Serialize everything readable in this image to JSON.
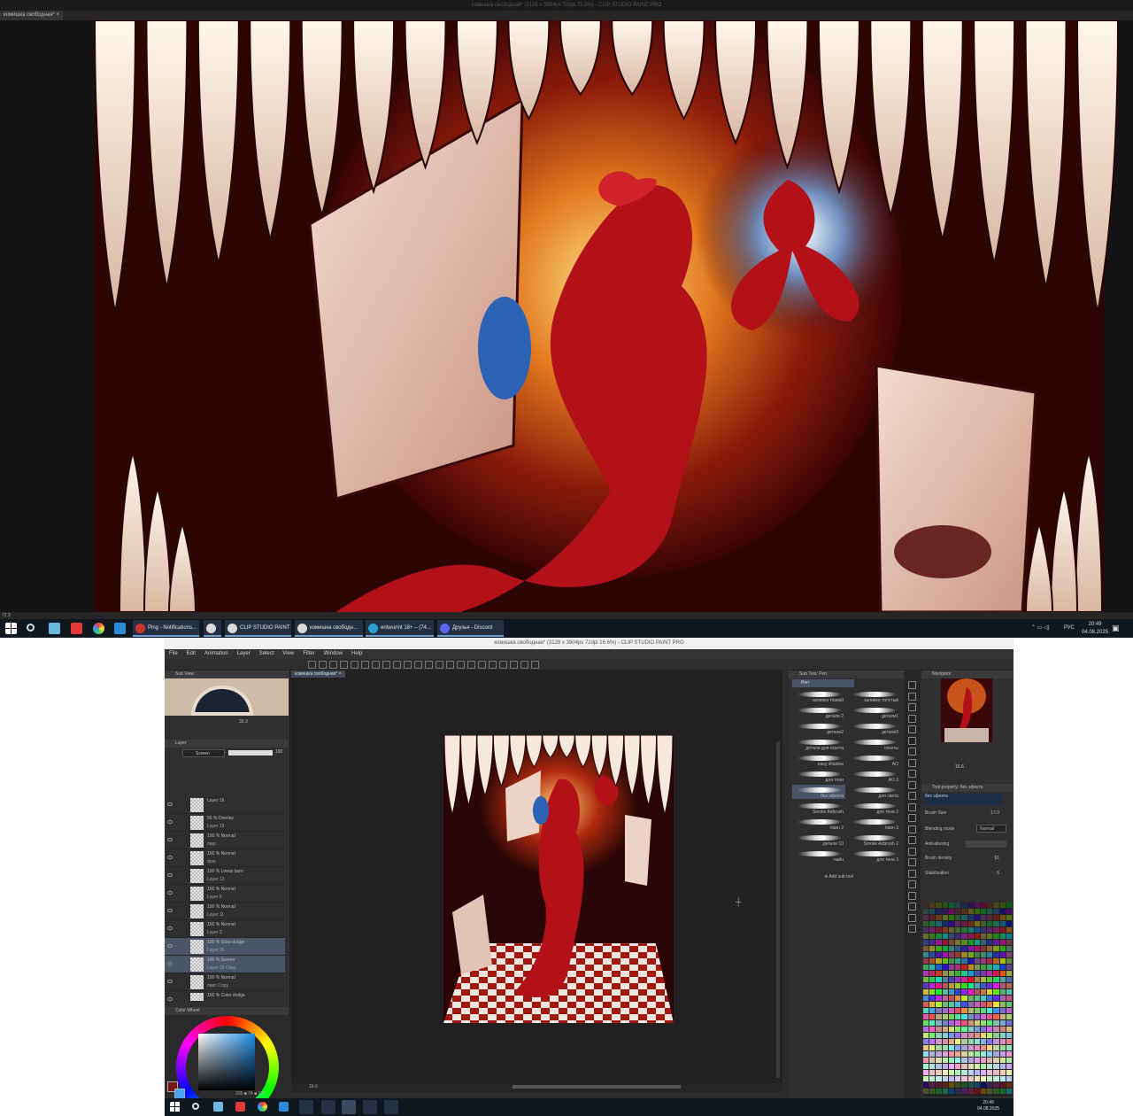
{
  "top": {
    "title": "комишка свободная* (3128 x 3904px 72dpi 72.8%)  - CLIP STUDIO PAINT PRO",
    "doc_tab": "комишка свободная*",
    "zoom": "72.9",
    "taskbar": {
      "apps": [
        {
          "label": "Ping - Notifications...",
          "color": "#c8372d"
        },
        {
          "label": "",
          "color": "#d9d9d9"
        },
        {
          "label": "CLIP STUDIO PAINT",
          "color": "#d9d9d9"
        },
        {
          "label": "комишка свободн...",
          "color": "#d9d9d9"
        },
        {
          "label": "entwurmt 18+ – (74...",
          "color": "#2aa0d8"
        },
        {
          "label": "Друзья - Discord",
          "color": "#5865f2"
        }
      ],
      "lang": "РУС",
      "time": "20:49",
      "date": "04.08.2025"
    }
  },
  "csp": {
    "title": "комишка свободная* (3128 x 3904px 72dpi 16.6%)  - CLIP STUDIO PAINT PRO",
    "menu": [
      "File",
      "Edit",
      "Animation",
      "Layer",
      "Select",
      "View",
      "Filter",
      "Window",
      "Help"
    ],
    "doc_tab": "комишка свободная*",
    "subview_label": "Sub View",
    "subview_zoom": "30.3",
    "layer_panel": "Layer",
    "blend": "Screen",
    "opacity": "100",
    "layers": [
      {
        "line1": "Layer 16",
        "line2": "",
        "sel": false
      },
      {
        "line1": "56 % Overlay",
        "line2": "Layer 19",
        "sel": false
      },
      {
        "line1": "100 % Normal",
        "line2": "перс",
        "sel": false
      },
      {
        "line1": "100 % Normal",
        "line2": "фон",
        "sel": false
      },
      {
        "line1": "100 % Linear burn",
        "line2": "Layer 12",
        "sel": false
      },
      {
        "line1": "100 % Normal",
        "line2": "Layer 5",
        "sel": false
      },
      {
        "line1": "100 % Normal",
        "line2": "Layer 11",
        "sel": false
      },
      {
        "line1": "100 % Normal",
        "line2": "Layer 3",
        "sel": false
      },
      {
        "line1": "100 % Glow dodge",
        "line2": "Layer 15",
        "sel": true
      },
      {
        "line1": "100 % Screen",
        "line2": "Layer 15 Copy",
        "sel": true
      },
      {
        "line1": "100 % Normal",
        "line2": "перс Copy",
        "sel": false
      },
      {
        "line1": "100 % Color dodge",
        "line2": "",
        "sel": false
      }
    ],
    "color_wheel": "Color Wheel",
    "color_status": "205 ■ 74 ■ 100",
    "canvas_zoom": "16.6",
    "subtool_panel": "Sub Tool: Pen",
    "subtool_group": "Pen",
    "brushes": [
      "заливка тонкий",
      "заливка толстый",
      "детали 2",
      "детали1",
      "детали2",
      "детали3",
      "детали для оскета",
      "оскеты",
      "easy shadow",
      "AO",
      "для тени",
      "AO 3",
      "без эфекта",
      "для света",
      "Smoke Airbrush",
      "для тени 2",
      "лаин 2",
      "лаин 3",
      "детали 10",
      "Smoke Airbrush 2",
      "лайн",
      "для тени 3"
    ],
    "add_subtool": "Add sub tool",
    "navigator": "Navigator",
    "nav_zoom": "16.6",
    "tool_property": "Tool property: без эфекта",
    "tool_property_brush": "без эфекта",
    "brush_size_label": "Brush Size",
    "brush_size": "17.0",
    "blending_label": "Blending mode",
    "blending_value": "Normal",
    "antialias_label": "Anti-aliasing",
    "density_label": "Brush density",
    "density_value": "61",
    "stabilization_label": "Stabilization",
    "stabilization_value": "6",
    "time": "20:49",
    "date": "04.08.2025"
  }
}
